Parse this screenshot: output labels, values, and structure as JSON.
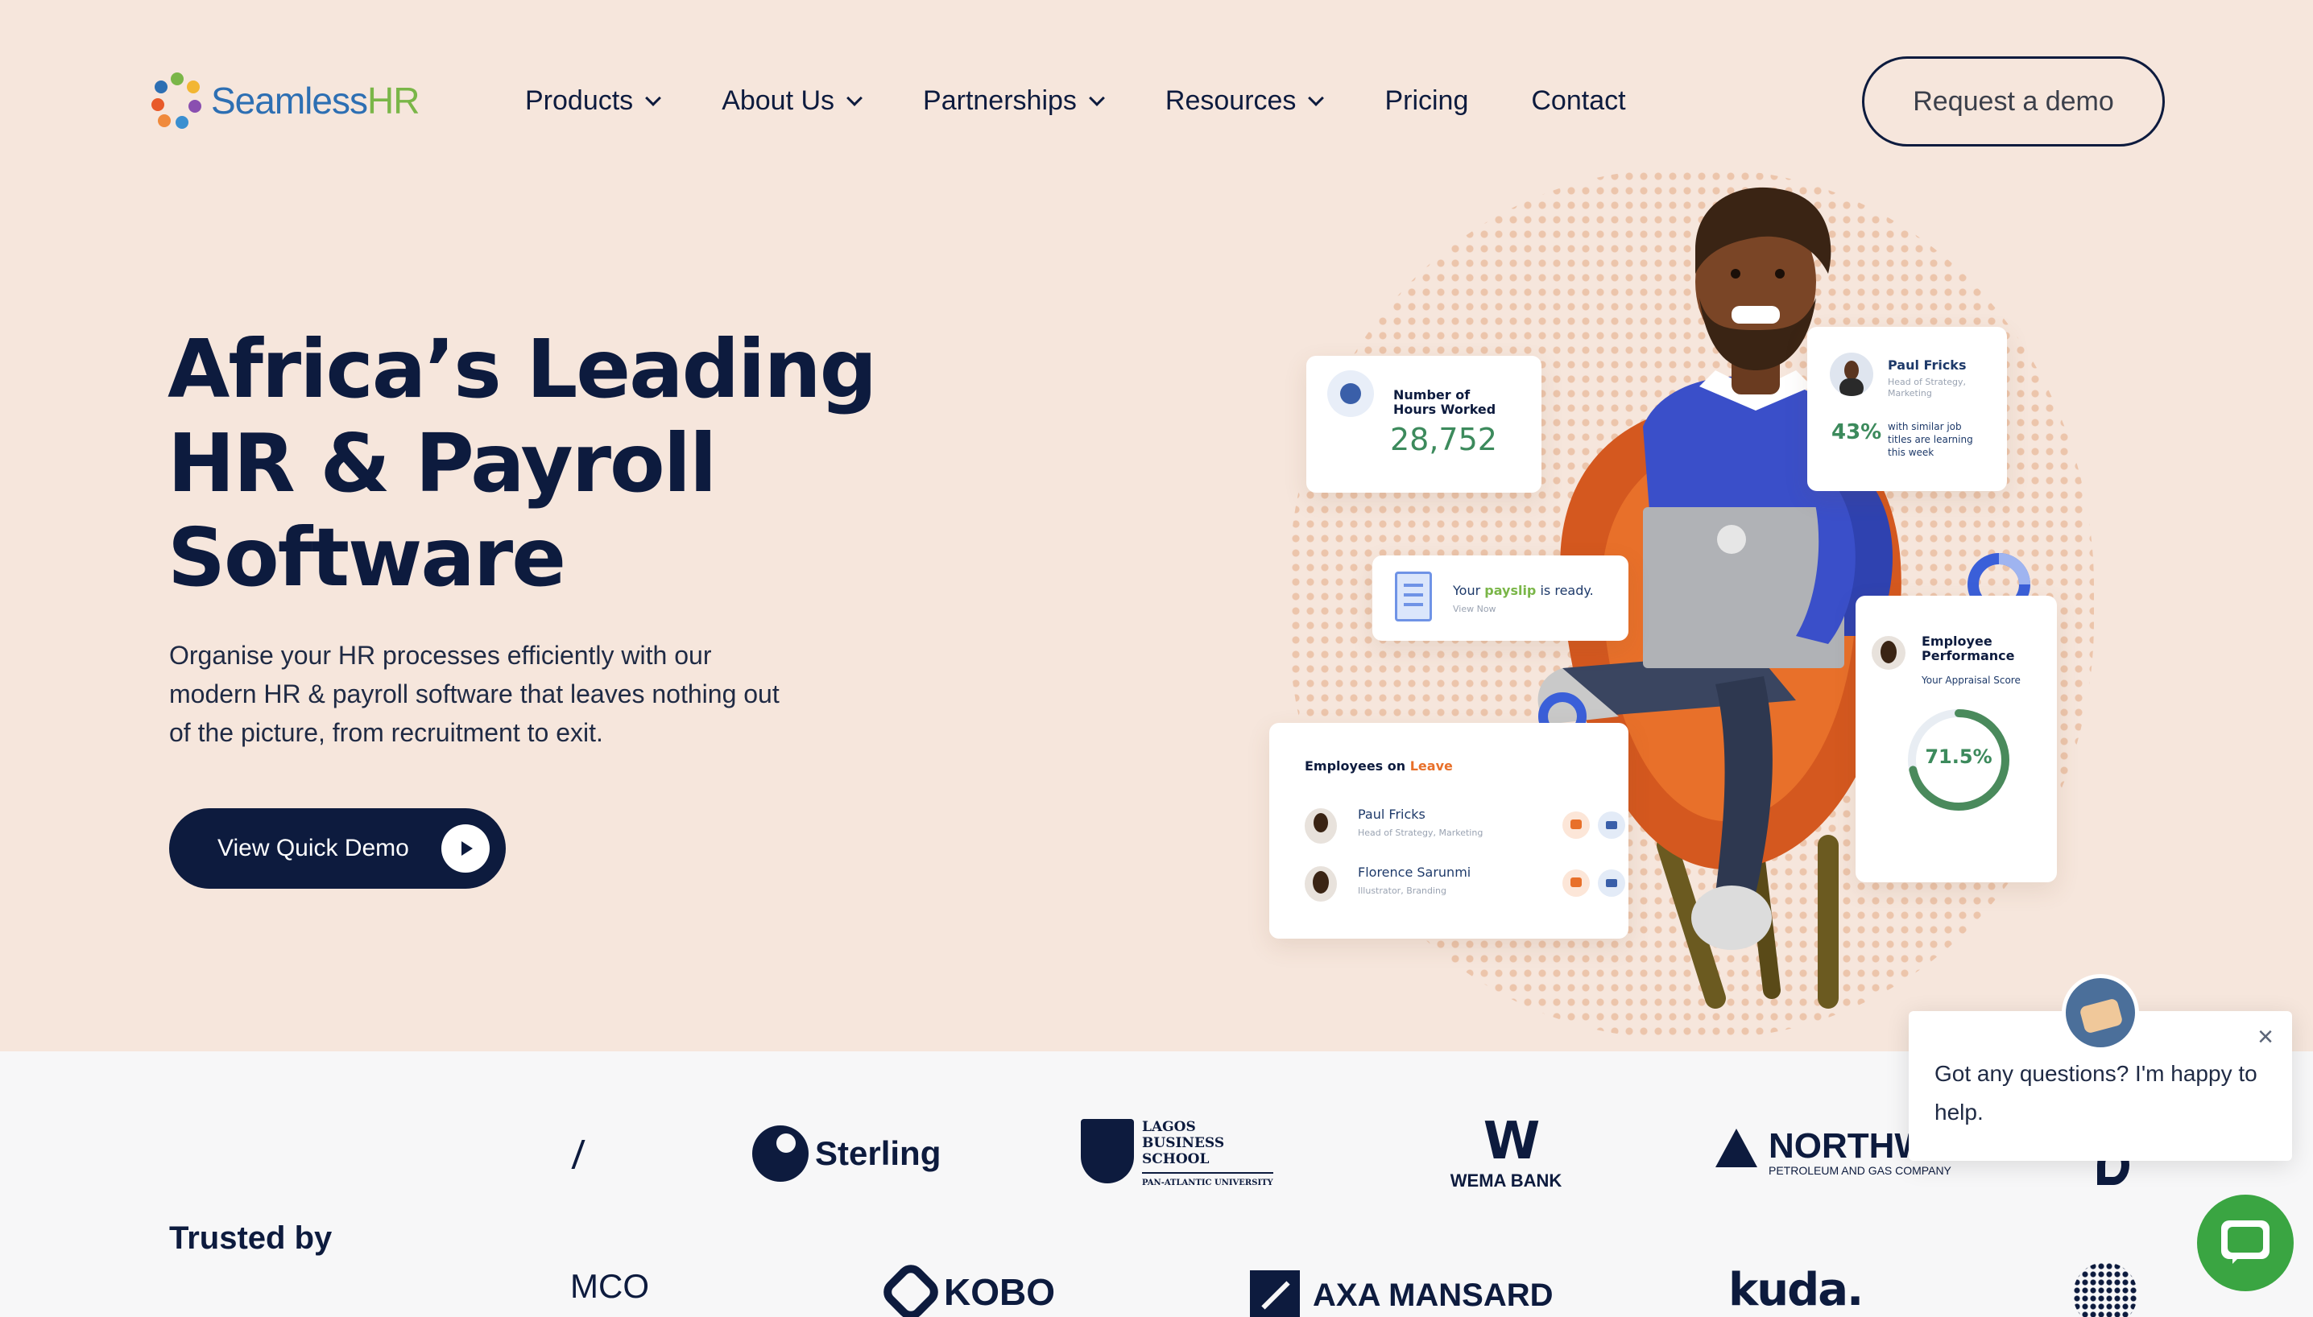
{
  "brand": {
    "name_part1": "Seamless",
    "name_part2": "HR"
  },
  "nav": {
    "items": [
      {
        "label": "Products",
        "has_dropdown": true
      },
      {
        "label": "About Us",
        "has_dropdown": true
      },
      {
        "label": "Partnerships",
        "has_dropdown": true
      },
      {
        "label": "Resources",
        "has_dropdown": true
      },
      {
        "label": "Pricing",
        "has_dropdown": false
      },
      {
        "label": "Contact",
        "has_dropdown": false
      }
    ],
    "cta": "Request a demo"
  },
  "hero": {
    "title_line1": "Africa’s Leading",
    "title_line2": "HR & Payroll",
    "title_line3": "Software",
    "subtitle": "Organise your HR processes efficiently with our modern HR & payroll software that leaves nothing out of the picture, from recruitment to exit.",
    "cta": "View Quick Demo"
  },
  "illustration": {
    "hours_card": {
      "label_line1": "Number of",
      "label_line2": "Hours Worked",
      "value": "28,752"
    },
    "profile_card": {
      "name": "Paul Fricks",
      "role_line1": "Head of Strategy,",
      "role_line2": "Marketing",
      "percent": "43%",
      "note_line1": "with similar job",
      "note_line2": "titles are learning",
      "note_line3": "this week"
    },
    "payslip_card": {
      "text_before": "Your ",
      "highlight": "payslip",
      "text_after": " is ready.",
      "link": "View Now"
    },
    "leave_card": {
      "title_prefix": "Employees on ",
      "title_highlight": "Leave",
      "employees": [
        {
          "name": "Paul Fricks",
          "role": "Head of Strategy, Marketing"
        },
        {
          "name": "Florence Sarunmi",
          "role": "Illustrator, Branding"
        }
      ]
    },
    "performance_card": {
      "title_line1": "Employee",
      "title_line2": "Performance",
      "subtitle": "Your Appraisal Score",
      "score": "71.5%",
      "score_fraction": 0.715
    }
  },
  "trusted": {
    "label": "Trusted by",
    "logos_row1": [
      "Sterling",
      "LAGOS",
      "BUSINESS",
      "SCHOOL",
      "PAN-ATLANTIC UNIVERSITY",
      "WEMA BANK",
      "NORTHW",
      "PETROLEUM AND GAS COMPANY"
    ],
    "logos_row2": [
      "MCO",
      "KOBO",
      "AXA MANSARD",
      "kuda."
    ]
  },
  "chat": {
    "message": "Got any questions? I'm happy to help."
  },
  "colors": {
    "background": "#f6e6dc",
    "navy": "#0d1b3e",
    "green": "#3aa542",
    "orange": "#e8702a",
    "accent_green": "#4a8a5c"
  }
}
